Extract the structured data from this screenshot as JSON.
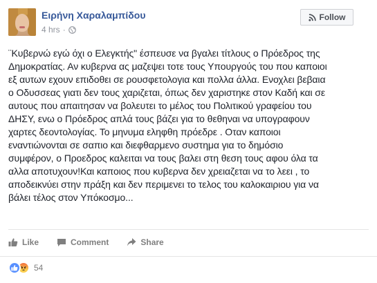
{
  "post": {
    "author": "Ειρήνη Χαραλαμπίδου",
    "time": "4 hrs",
    "separator": "·",
    "privacy_icon": "globe-icon",
    "follow_label": "Follow",
    "follow_icon": "rss-icon",
    "text_lines": [
      "¨Κυβερνώ εγώ όχι ο Ελεγκτής\" έσπευσε να βγαλει τίτλους ο Πρόεδρος της",
      "Δημοκρατίας. Αν κυβερνα ας μαζεψει τοτε τους Υπουργούς του που καποιοι",
      "εξ αυτων εχουν επιδοθει σε ρουσφετολογια και πολλα άλλα. Ενοχλει βεβαια",
      "ο Οδυσσεας γιατι δεν τους χαριζεται, όπως δεν χαριστηκε στον Καδή και σε",
      "αυτους που απαιτησαν να βολευτει το μέλος του Πολιτικού γραφείου του",
      "ΔΗΣΥ, ενω ο Πρόεδρος απλά τους βάζει για το θεθηναι να υπογραφουν",
      "χαρτες δεοντολογίας. Το μηνυμα εληφθη πρόεδρε . Οταν καποιοι",
      "εναντιώνονται σε σαπιο και διεφθαρμενο συστημα για το δημόσιο",
      "συμφέρον, ο Προεδρος καλειται να τους βαλει στη θεση τους αφου όλα τα",
      "αλλα αποτυχουν!Και καποιος που κυβερνα δεν χρειαζεται να το λεει , το",
      "αποδεικνύει στην πράξη και δεν περιμενει το τελος του καλοκαιριου για να",
      "βάλει τέλος στον Υπόκοσμο..."
    ]
  },
  "actions": {
    "like_label": "Like",
    "comment_label": "Comment",
    "share_label": "Share"
  },
  "reactions": {
    "count": "54",
    "types": [
      "like-icon",
      "angry-icon"
    ]
  },
  "colors": {
    "author": "#365899",
    "meta": "#90949c",
    "like_reaction": "#5890ff",
    "action_text": "#7f7f7f"
  }
}
